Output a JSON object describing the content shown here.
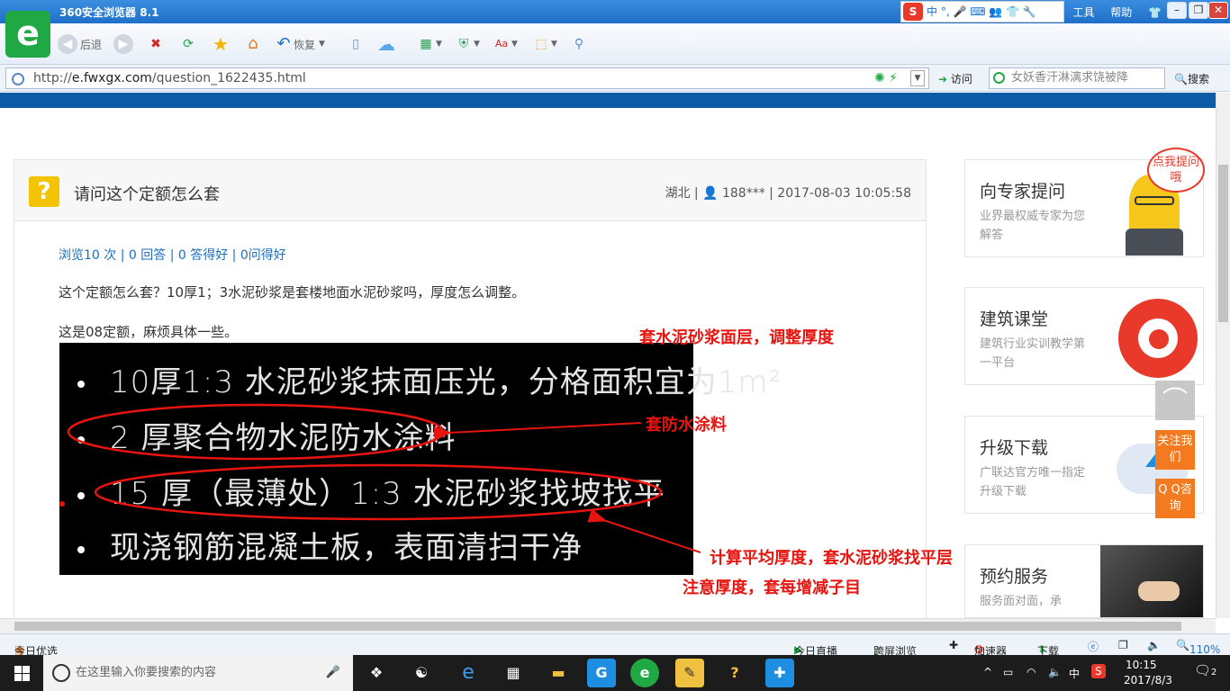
{
  "window": {
    "title": "360安全浏览器 8.1",
    "menu": [
      "工具",
      "帮助"
    ]
  },
  "ime": {
    "label": "中 °, 🎤 ⌨ 👥 👕 🔧"
  },
  "toolbar": {
    "back": "后退",
    "restore": "恢复"
  },
  "address": {
    "scheme": "http://",
    "host": "e.fwxgx.com",
    "path": "/question_1622435.html",
    "visit": "访问",
    "search_text": "女妖香汗淋漓求饶被降",
    "search_btn": "搜索"
  },
  "question": {
    "title": "请问这个定额怎么套",
    "meta": "湖北 | 👤 188*** | 2017-08-03 10:05:58",
    "stats": "浏览10 次 | 0 回答 | 0 答得好 | 0问得好",
    "body1": "这个定额怎么套？10厚1；3水泥砂浆是套楼地面水泥砂浆吗，厚度怎么调整。",
    "body2": "这是08定额，麻烦具体一些。"
  },
  "cad_lines": [
    "10厚1:3 水泥砂浆抹面压光，分格面积宜为1m²",
    "2 厚聚合物水泥防水涂料",
    "15 厚（最薄处）1:3 水泥砂浆找坡找平",
    "现浇钢筋混凝土板，表面清扫干净"
  ],
  "annotations": {
    "a1": "套水泥砂浆面层，调整厚度",
    "a2": "套防水涂料",
    "a3": "计算平均厚度，套水泥砂浆找平层",
    "a4": "注意厚度，套每增减子目"
  },
  "sidebar": [
    {
      "title": "向专家提问",
      "desc": "业界最权威专家为您解答",
      "badge": "点我提问哦"
    },
    {
      "title": "建筑课堂",
      "desc": "建筑行业实训教学第一平台"
    },
    {
      "title": "升级下载",
      "desc": "广联达官方唯一指定升级下载"
    },
    {
      "title": "预约服务",
      "desc": "服务面对面，承"
    }
  ],
  "floats": {
    "follow": "关注我们",
    "qq": "Q Q咨询"
  },
  "status": {
    "left": "今日优选",
    "live": "今日直播",
    "cross": "跨屏浏览",
    "accel": "加速器",
    "download": "下载",
    "zoom": "110%"
  },
  "taskbar": {
    "search_placeholder": "在这里输入你要搜索的内容",
    "time": "10:15",
    "date": "2017/8/3",
    "lang": "中",
    "notif": "2"
  },
  "colors": {
    "accent": "#0b5ba7",
    "annotation": "#e8140f",
    "orange": "#f37a1f"
  }
}
